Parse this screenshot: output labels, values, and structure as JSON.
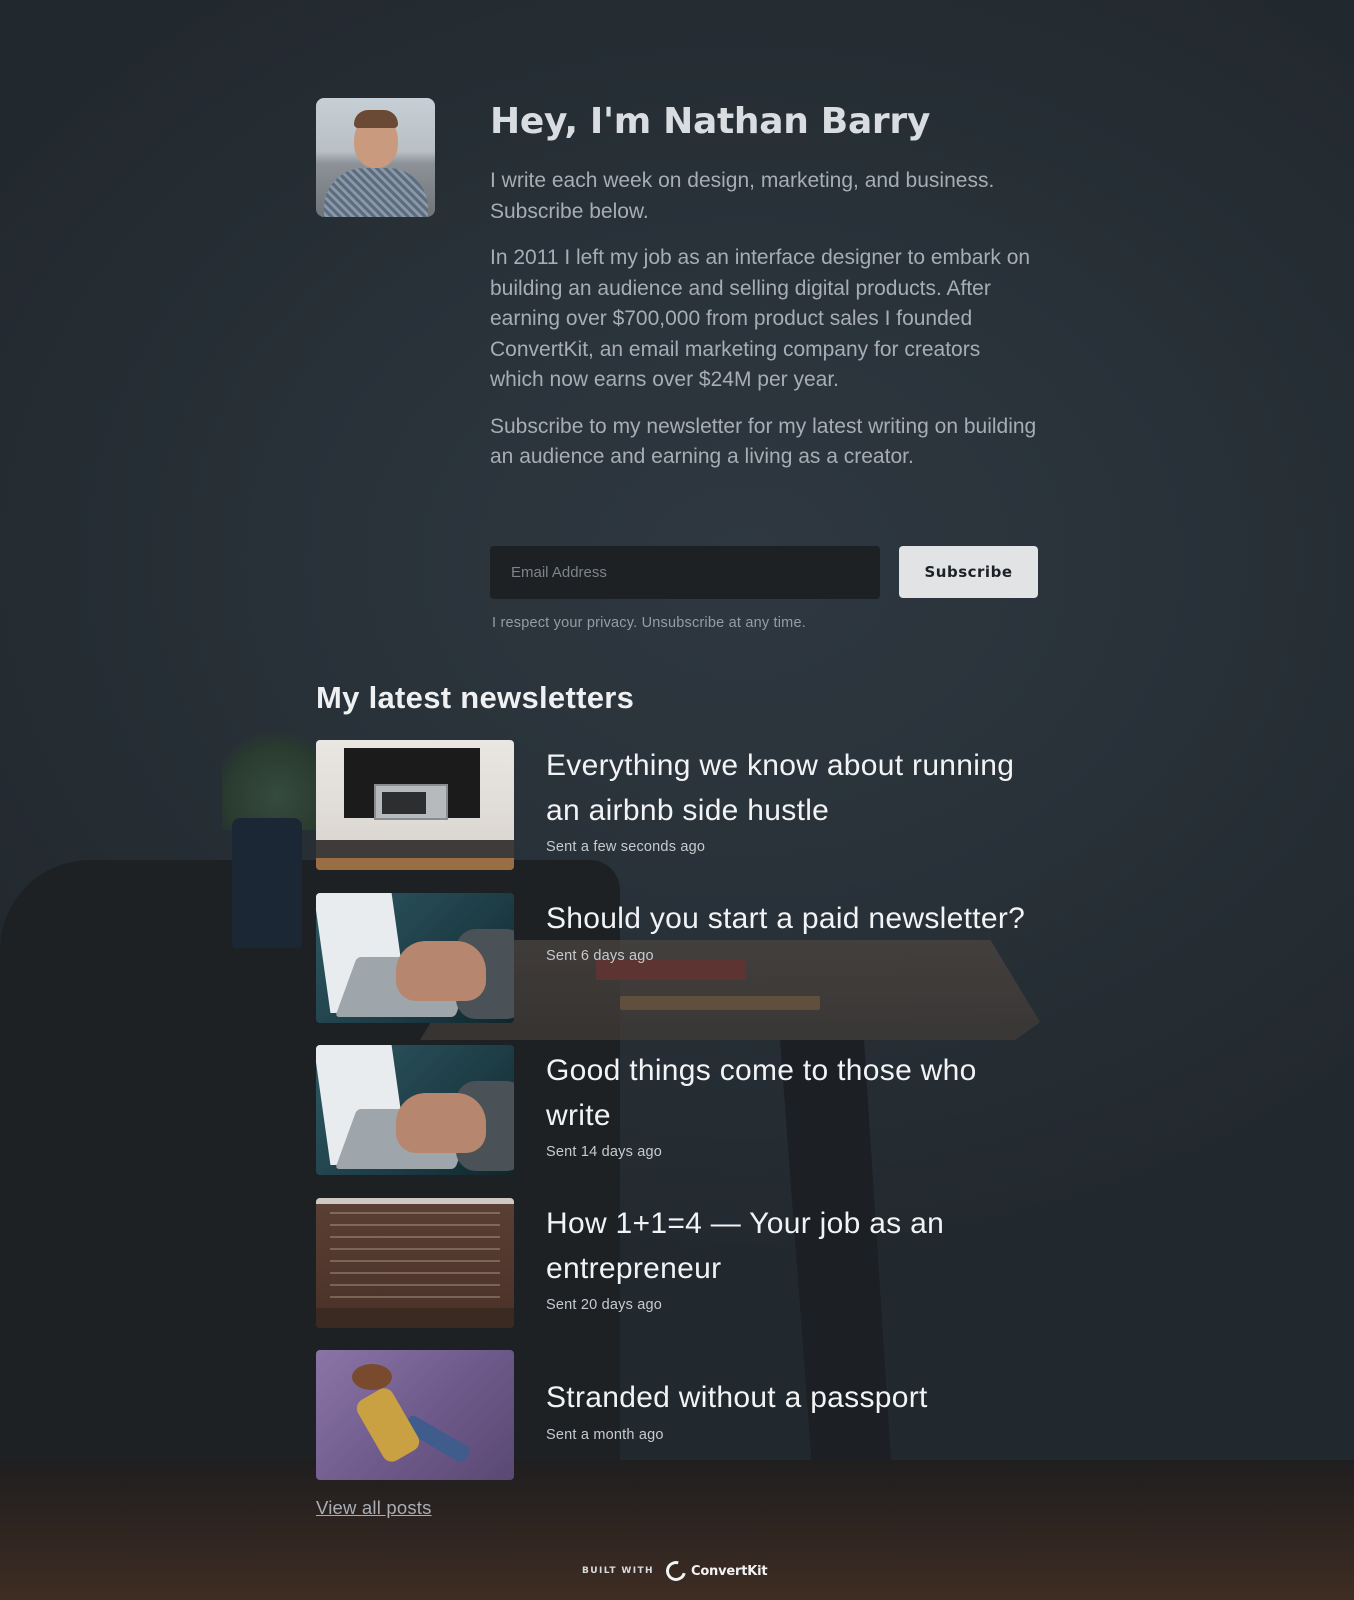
{
  "profile": {
    "title": "Hey, I'm Nathan Barry",
    "paragraphs": [
      "I write each week on design, marketing, and business. Subscribe below.",
      "In 2011 I left my job as an interface designer to embark on building an audience and selling digital products. After earning over $700,000 from product sales I founded ConvertKit, an email marketing company for creators which now earns over $24M per year.",
      "Subscribe to my newsletter for my latest writing on building an audience and earning a living as a creator."
    ]
  },
  "form": {
    "email_placeholder": "Email Address",
    "email_value": "",
    "subscribe_label": "Subscribe",
    "privacy_note": "I respect your privacy. Unsubscribe at any time."
  },
  "newsletters": {
    "heading": "My latest newsletters",
    "posts": [
      {
        "title": "Everything we know about running an airbnb side hustle",
        "date": "Sent a few seconds ago",
        "thumbnail": "kitchen-photo"
      },
      {
        "title": "Should you start a paid newsletter?",
        "date": "Sent 6 days ago",
        "thumbnail": "laptop-typing-photo"
      },
      {
        "title": "Good things come to those who write",
        "date": "Sent 14 days ago",
        "thumbnail": "laptop-typing-photo"
      },
      {
        "title": "How 1+1=4 — Your job as an entrepreneur",
        "date": "Sent 20 days ago",
        "thumbnail": "chalkboard-photo"
      },
      {
        "title": "Stranded without a passport",
        "date": "Sent a month ago",
        "thumbnail": "toy-figure-photo"
      }
    ],
    "view_all_label": "View all posts"
  },
  "footer": {
    "built_with": "BUILT WITH",
    "brand": "ConvertKit",
    "brand_icon": "convertkit-logo-icon"
  },
  "colors": {
    "background": "#2c3338",
    "button": "#e1e3e5",
    "input": "#1e2124"
  }
}
